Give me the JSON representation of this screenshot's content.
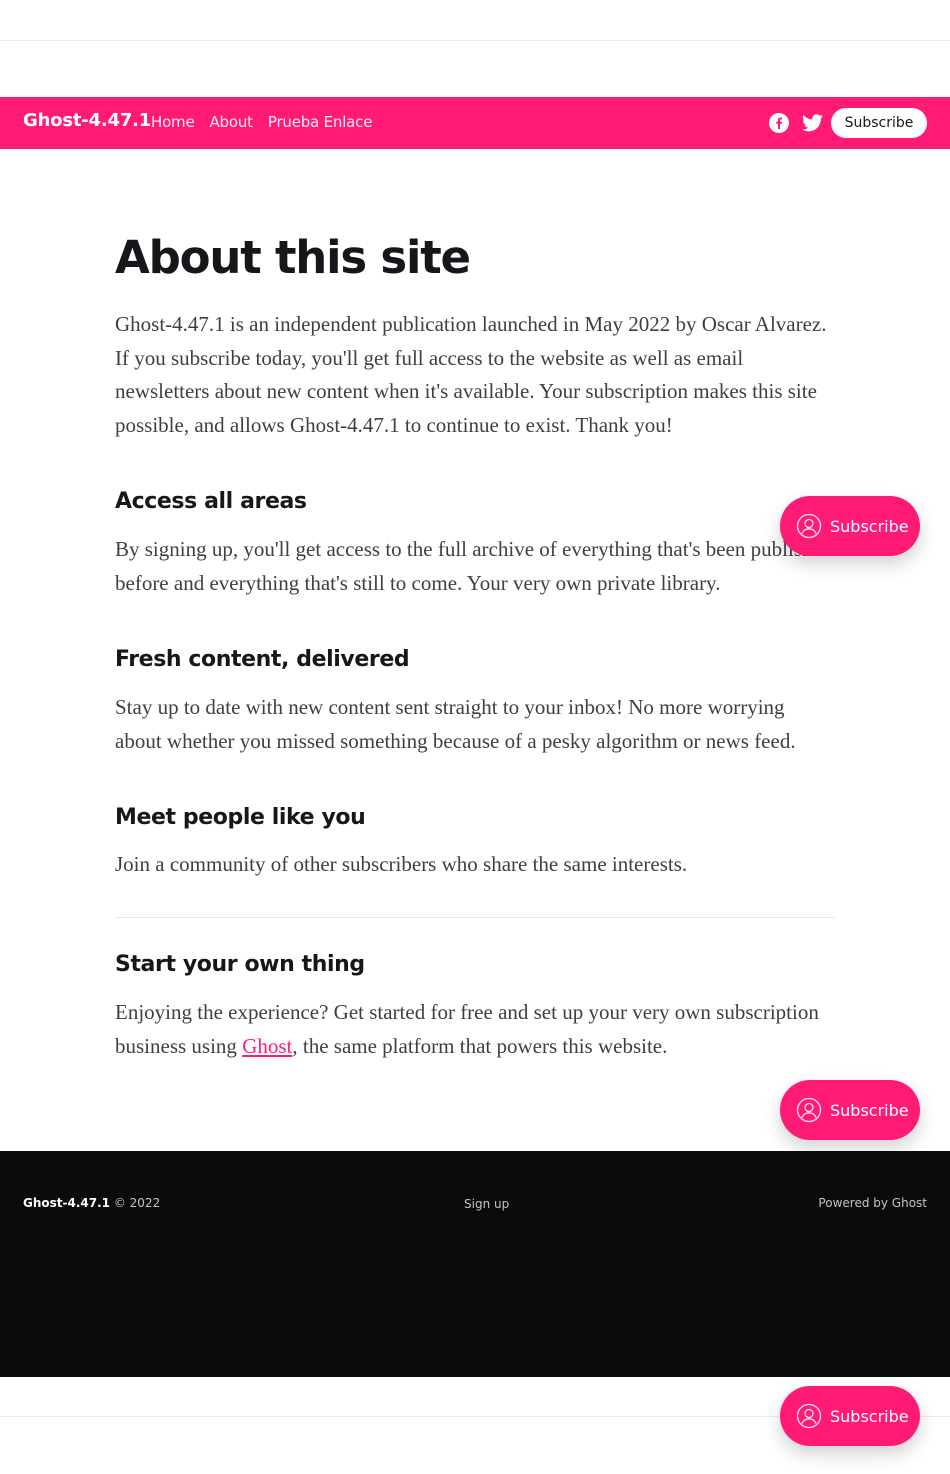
{
  "header": {
    "site_title": "Ghost-4.47.1",
    "nav": [
      {
        "label": "Home"
      },
      {
        "label": "About"
      },
      {
        "label": "Prueba Enlace"
      }
    ],
    "social_icons": [
      "facebook-icon",
      "twitter-icon"
    ],
    "subscribe_label": "Subscribe",
    "background_color": "#ff1a75"
  },
  "page": {
    "title": "About this site",
    "intro": "Ghost-4.47.1 is an independent publication launched in May 2022 by Oscar Alvarez. If you subscribe today, you'll get full access to the website as well as email newsletters about new content when it's available. Your subscription makes this site possible, and allows Ghost-4.47.1 to continue to exist. Thank you!",
    "sections": [
      {
        "heading": "Access all areas",
        "body": "By signing up, you'll get access to the full archive of everything that's been published before and everything that's still to come. Your very own private library."
      },
      {
        "heading": "Fresh content, delivered",
        "body": "Stay up to date with new content sent straight to your inbox! No more worrying about whether you missed something because of a pesky algorithm or news feed."
      },
      {
        "heading": "Meet people like you",
        "body": "Join a community of other subscribers who share the same interests."
      }
    ],
    "start": {
      "heading": "Start your own thing",
      "body_before": "Enjoying the experience? Get started for free and set up your very own subscription business using ",
      "link_text": "Ghost",
      "body_after": ", the same platform that powers this website."
    }
  },
  "floating_subscribe": {
    "label": "Subscribe",
    "icon": "user-circle-icon",
    "color": "#ff1a75"
  },
  "footer": {
    "brand": "Ghost-4.47.1",
    "copyright": "© 2022",
    "signup": "Sign up",
    "powered": "Powered by Ghost",
    "background_color": "#0a0b0c"
  }
}
